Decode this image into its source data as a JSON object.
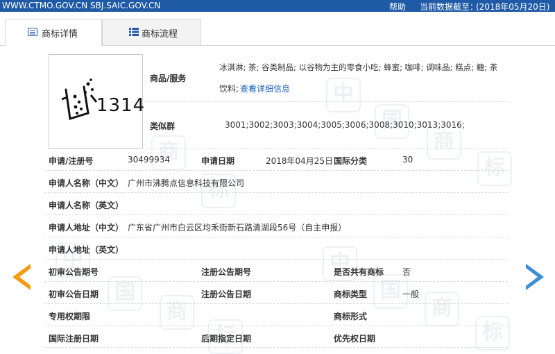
{
  "topbar": {
    "site": "WWW.CTMO.GOV.CN  SBJ.SAIC.GOV.CN",
    "help": "帮助",
    "date_label": "当前数据截至：",
    "date_value": "(2018年05月20日)"
  },
  "tabs": [
    {
      "label": "商标详情",
      "icon": "doc-list-icon"
    },
    {
      "label": "商标流程",
      "icon": "flow-list-icon"
    }
  ],
  "trademark": {
    "logo_text": "1314",
    "goods_label": "商品/服务",
    "goods_value_line1": "冰淇淋; 茶; 谷类制品; 以谷物为主的零食小吃; 蜂蜜; 咖啡; 调味品; 糕点; 糖; 茶",
    "goods_value_line2": "饮料;",
    "goods_link": "查看详细信息",
    "similar_label": "类似群",
    "similar_value": "3001;3002;3003;3004;3005;3006;3008;3010;3013;3016;"
  },
  "fields": {
    "reg_no_label": "申请/注册号",
    "reg_no_value": "30499934",
    "app_date_label": "申请日期",
    "app_date_value": "2018年04月25日",
    "intl_class_label": "国际分类",
    "intl_class_value": "30",
    "applicant_cn_label": "申请人名称（中文）",
    "applicant_cn_value": "广州市沸腾点信息科技有限公司",
    "applicant_en_label": "申请人名称（英文）",
    "address_cn_label": "申请人地址（中文）",
    "address_cn_value": "广东省广州市白云区均禾街新石路清湖段56号（自主申报）",
    "address_en_label": "申请人地址（英文）",
    "prelim_no_label": "初审公告期号",
    "reg_pub_no_label": "注册公告期号",
    "shared_label": "是否共有商标",
    "shared_value": "否",
    "prelim_date_label": "初审公告日期",
    "reg_pub_date_label": "注册公告日期",
    "tm_type_label": "商标类型",
    "tm_type_value": "一般",
    "exclusive_label": "专用权期限",
    "tm_form_label": "商标形式",
    "intl_reg_date_label": "国际注册日期",
    "later_date_label": "后期指定日期",
    "priority_date_label": "优先权日期"
  },
  "colors": {
    "topbar": "#1f5aa6",
    "link": "#1a63b7",
    "prev_arrow": "#f39c12",
    "next_arrow": "#3a8fd8"
  }
}
